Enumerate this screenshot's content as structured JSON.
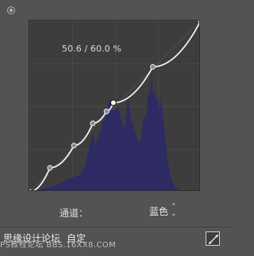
{
  "header": {
    "settings_icon": "gear-icon"
  },
  "curve": {
    "readout": "50.6 / 60.0 %",
    "grid_divisions": 4,
    "histogram_color": "#2c2968",
    "curve_color": "#f1f1f1",
    "control_points": [
      [
        0,
        0
      ],
      [
        0.12,
        0.14
      ],
      [
        0.26,
        0.27
      ],
      [
        0.37,
        0.4
      ],
      [
        0.45,
        0.47
      ],
      [
        0.49,
        0.52
      ],
      [
        0.72,
        0.73
      ],
      [
        1.0,
        1.0
      ]
    ]
  },
  "channel": {
    "label": "通道：",
    "value": "蓝色"
  },
  "bottom": {
    "left_text": "思缘设计论坛",
    "mode_text": "自定",
    "watermark": "PS教程论坛 BBS.16XX8.COM"
  },
  "colors": {
    "panel_bg": "#535353",
    "curve_bg": "#3d3d3d"
  }
}
